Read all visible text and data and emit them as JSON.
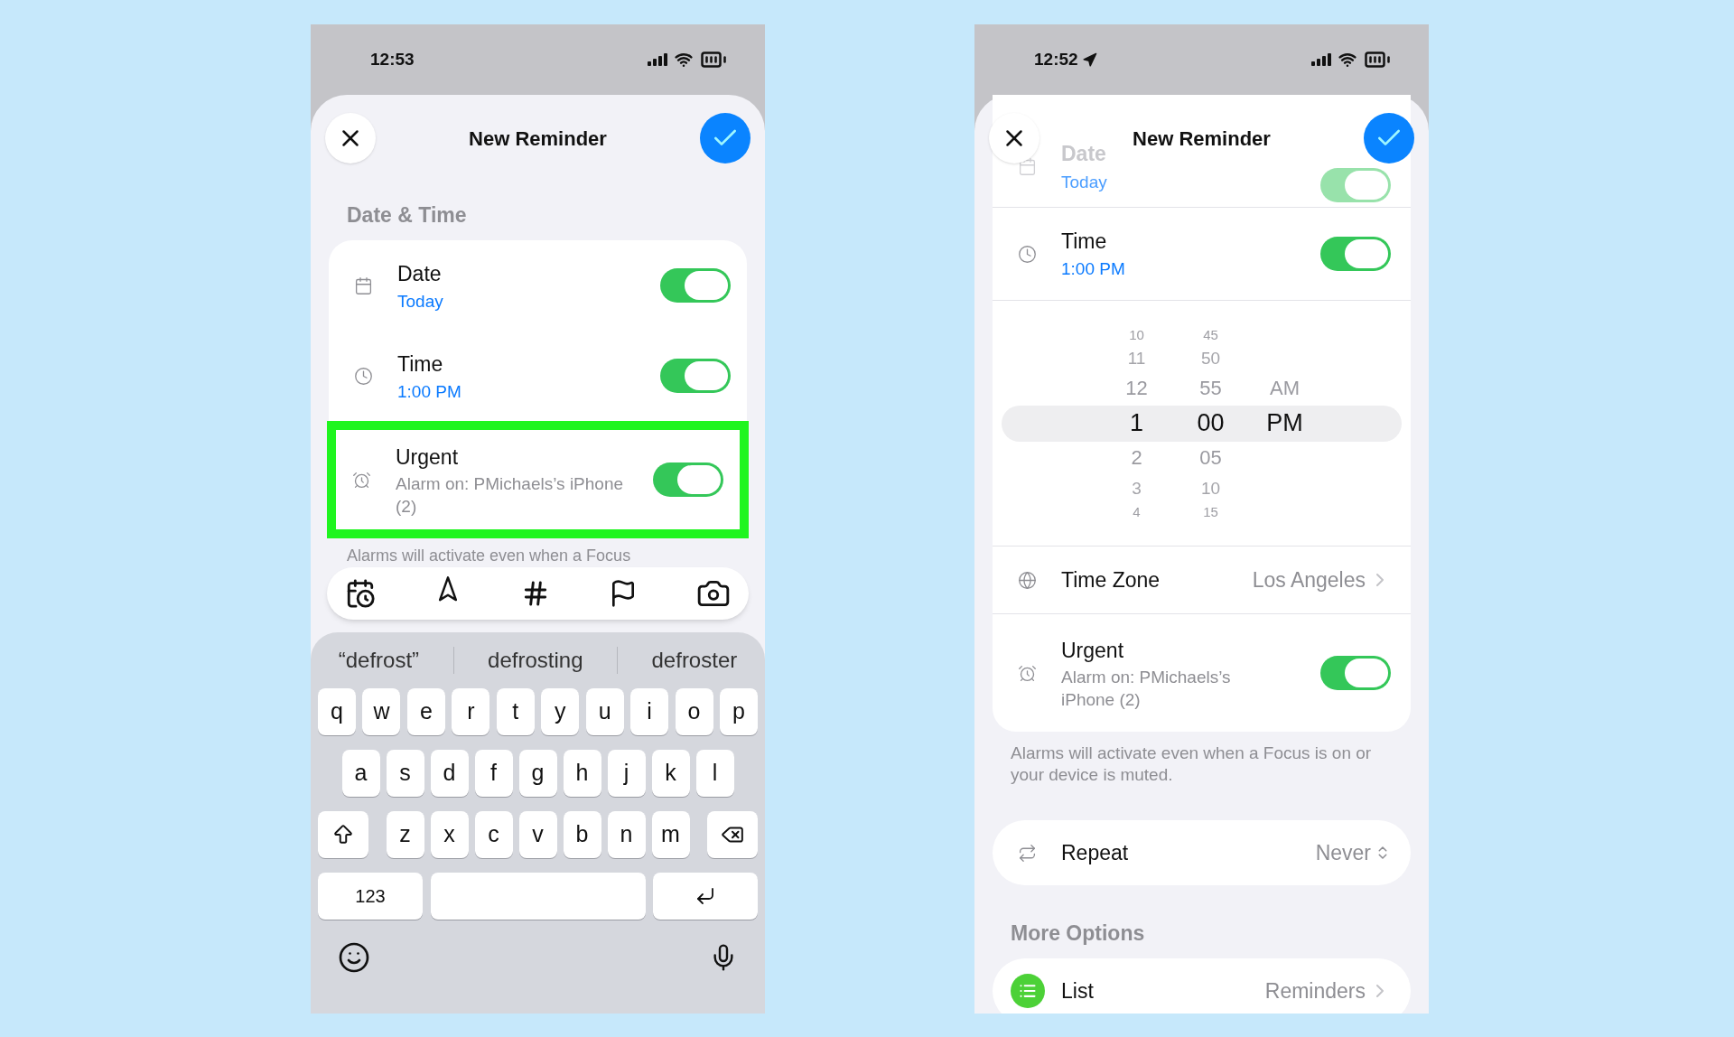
{
  "left_phone": {
    "status_bar": {
      "time": "12:53",
      "location": false
    },
    "header": {
      "title": "New Reminder"
    },
    "section_title": "Date & Time",
    "rows": [
      {
        "kind": "date",
        "label": "Date",
        "value": "Today",
        "on": true,
        "highlighted": false
      },
      {
        "kind": "time",
        "label": "Time",
        "value": "1:00 PM",
        "on": true,
        "highlighted": false
      },
      {
        "kind": "alarm",
        "label": "Urgent",
        "value": "Alarm on: PMichaels’s iPhone (2)",
        "on": true,
        "highlighted": true
      }
    ],
    "footnote": "Alarms will activate even when a Focus",
    "keyboard": {
      "suggestions": [
        "“defrost”",
        "defrosting",
        "defroster"
      ],
      "letter_rows": [
        [
          "q",
          "w",
          "e",
          "r",
          "t",
          "y",
          "u",
          "i",
          "o",
          "p"
        ],
        [
          "a",
          "s",
          "d",
          "f",
          "g",
          "h",
          "j",
          "k",
          "l"
        ],
        [
          "z",
          "x",
          "c",
          "v",
          "b",
          "n",
          "m"
        ]
      ],
      "numbers_key": "123"
    }
  },
  "right_phone": {
    "status_bar": {
      "time": "12:52",
      "location": true
    },
    "header": {
      "title": "New Reminder"
    },
    "scrolled_row": {
      "label": "Date",
      "value": "Today",
      "on": true
    },
    "time_row": {
      "label": "Time",
      "value": "1:00 PM",
      "on": true
    },
    "picker": {
      "hours": [
        {
          "text": "10",
          "selected": false
        },
        {
          "text": "11",
          "selected": false
        },
        {
          "text": "12",
          "selected": false
        },
        {
          "text": "1",
          "selected": true
        },
        {
          "text": "2",
          "selected": false
        },
        {
          "text": "3",
          "selected": false
        },
        {
          "text": "4",
          "selected": false
        }
      ],
      "minutes": [
        {
          "text": "45",
          "selected": false
        },
        {
          "text": "50",
          "selected": false
        },
        {
          "text": "55",
          "selected": false
        },
        {
          "text": "00",
          "selected": true
        },
        {
          "text": "05",
          "selected": false
        },
        {
          "text": "10",
          "selected": false
        },
        {
          "text": "15",
          "selected": false
        }
      ],
      "periods": [
        {
          "text": "AM",
          "selected": false
        },
        {
          "text": "PM",
          "selected": true
        }
      ]
    },
    "time_zone": {
      "label": "Time Zone",
      "value": "Los Angeles"
    },
    "urgent_row": {
      "label": "Urgent",
      "value": "Alarm on: PMichaels’s iPhone (2)",
      "on": true
    },
    "footnote": "Alarms will activate even when a Focus is on or your device is muted.",
    "repeat": {
      "label": "Repeat",
      "value": "Never"
    },
    "more_options_title": "More Options",
    "list_row": {
      "label": "List",
      "value": "Reminders"
    }
  }
}
